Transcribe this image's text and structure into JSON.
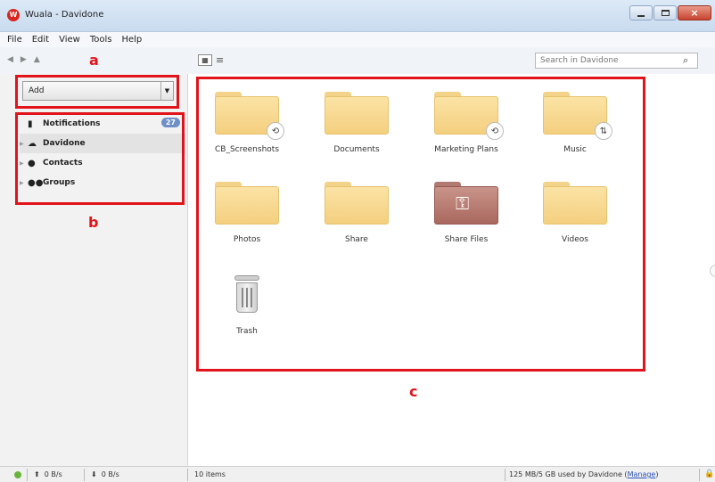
{
  "window": {
    "title": "Wuala - Davidone",
    "logo_letter": "W"
  },
  "menu": [
    "File",
    "Edit",
    "View",
    "Tools",
    "Help"
  ],
  "toolbar": {
    "search_placeholder": "Search in Davidone"
  },
  "sidebar": {
    "add_label": "Add",
    "items": [
      {
        "label": "Notifications",
        "icon": "bookmark-icon",
        "badge": "27"
      },
      {
        "label": "Davidone",
        "icon": "cloud-icon"
      },
      {
        "label": "Contacts",
        "icon": "person-icon"
      },
      {
        "label": "Groups",
        "icon": "people-icon"
      }
    ]
  },
  "annotations": {
    "a": "a",
    "b": "b",
    "c": "c"
  },
  "files": [
    {
      "label": "CB_Screenshots",
      "type": "folder",
      "overlay": "history-icon"
    },
    {
      "label": "Documents",
      "type": "folder"
    },
    {
      "label": "Marketing Plans",
      "type": "folder",
      "overlay": "history-icon"
    },
    {
      "label": "Music",
      "type": "folder",
      "overlay": "sync-icon"
    },
    {
      "label": "Photos",
      "type": "folder"
    },
    {
      "label": "Share",
      "type": "folder"
    },
    {
      "label": "Share Files",
      "type": "shared-folder"
    },
    {
      "label": "Videos",
      "type": "folder"
    },
    {
      "label": "Trash",
      "type": "trash"
    }
  ],
  "status": {
    "upload_rate": "0 B/s",
    "download_rate": "0 B/s",
    "item_count": "10 items",
    "usage": "125 MB/5 GB used by Davidone",
    "manage_link": "Manage"
  },
  "colors": {
    "annotation_red": "#e0141a",
    "folder_yellow": "#f4cf7f",
    "online_green": "#69b33b"
  }
}
